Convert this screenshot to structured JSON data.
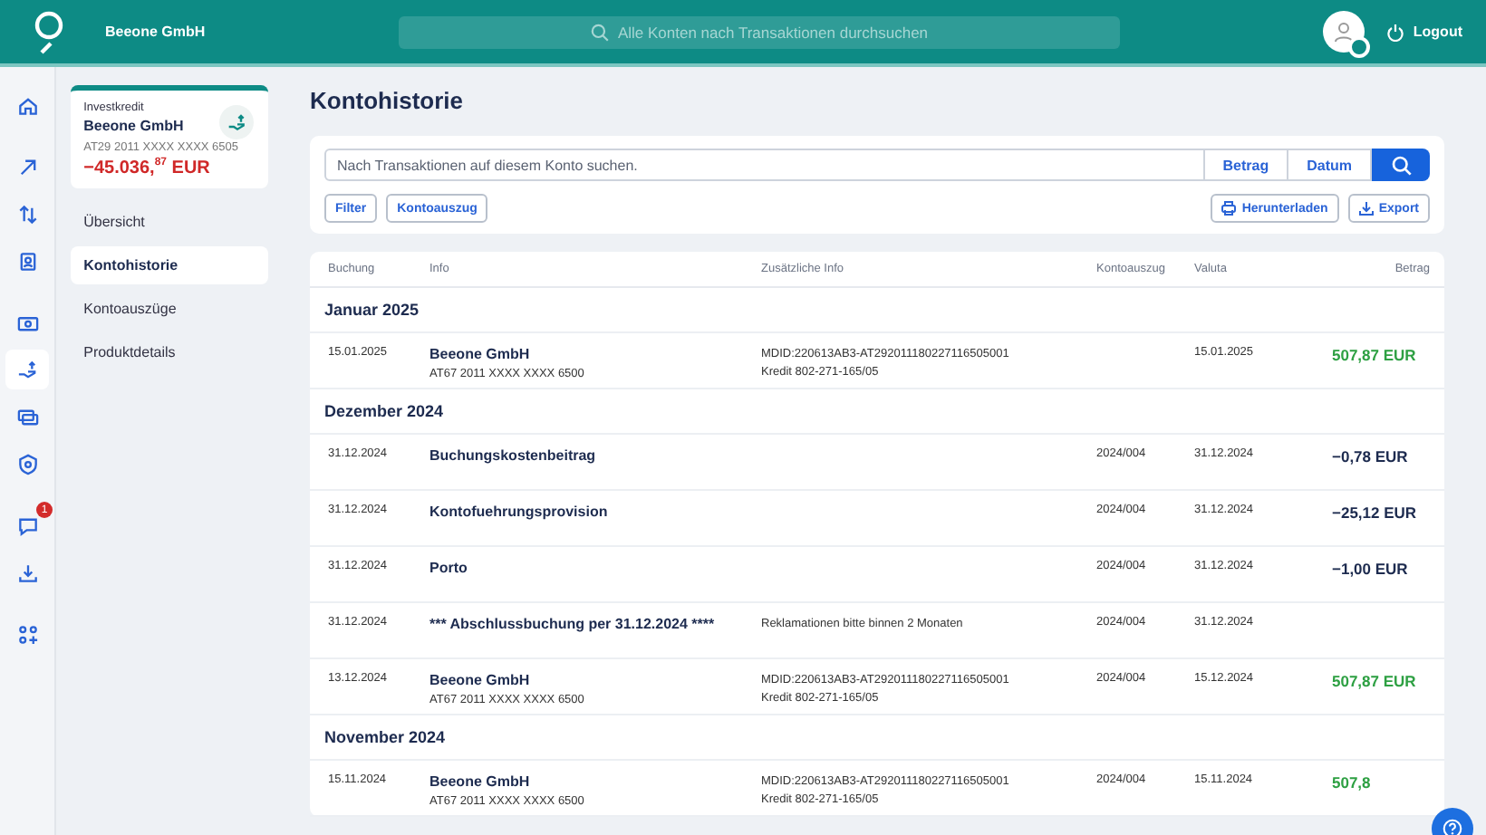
{
  "header": {
    "company": "Beeone GmbH",
    "search_placeholder": "Alle Konten nach Transaktionen durchsuchen",
    "logout": "Logout"
  },
  "rail": [
    {
      "selected": false
    },
    {
      "selected": false
    },
    {
      "selected": false
    },
    {
      "selected": false
    },
    {
      "selected": false
    },
    {
      "selected": true
    },
    {
      "selected": false
    },
    {
      "selected": false
    },
    {
      "selected": false,
      "badge": "1"
    },
    {
      "selected": false
    },
    {
      "selected": false
    }
  ],
  "account": {
    "type": "Investkredit",
    "name": "Beeone GmbH",
    "iban": "AT29 2011 XXXX XXXX 6505",
    "balance": "−45.036,$^{87}$ EUR"
  },
  "nav": [
    {
      "label": "Übersicht",
      "selected": false
    },
    {
      "label": "Kontohistorie",
      "selected": true
    },
    {
      "label": "Kontoauszüge",
      "selected": false
    },
    {
      "label": "Produktdetails",
      "selected": false
    }
  ],
  "title": "Kontohistorie",
  "search": {
    "placeholder": "Nach Transaktionen auf diesem Konto suchen.",
    "buttons": [
      "Betrag",
      "Datum"
    ]
  },
  "filters": [
    "Filter",
    "Kontoauszug"
  ],
  "actions": [
    "Herunterladen",
    "Export"
  ],
  "table": {
    "columns": [
      "Buchung",
      "Info",
      "Zusätzliche Info",
      "Kontoauszug",
      "Valuta",
      "Betrag"
    ],
    "groups": [
      {
        "label": "Januar 2025",
        "rows": [
          {
            "date": "15.01.2025",
            "title": "Beeone GmbH",
            "sub": "AT67 2011 XXXX XXXX 6500",
            "info": [
              "MDID:220613AB3-AT292011180227116505001",
              "Kredit 802-271-165/05"
            ],
            "valuta": "15.01.2025",
            "amount": "507,87 EUR",
            "kind": "credit"
          }
        ]
      },
      {
        "label": "Dezember 2024",
        "rows": [
          {
            "date": "31.12.2024",
            "title": "Buchungskostenbeitrag",
            "statement": "2024/004",
            "valuta": "31.12.2024",
            "amount": "−0,78 EUR",
            "kind": "debit"
          },
          {
            "date": "31.12.2024",
            "title": "Kontofuehrungsprovision",
            "statement": "2024/004",
            "valuta": "31.12.2024",
            "amount": "−25,12 EUR",
            "kind": "debit"
          },
          {
            "date": "31.12.2024",
            "title": "Porto",
            "statement": "2024/004",
            "valuta": "31.12.2024",
            "amount": "−1,00 EUR",
            "kind": "debit"
          },
          {
            "date": "31.12.2024",
            "title": "*** Abschlussbuchung per 31.12.2024 ****",
            "info": [
              "Reklamationen bitte binnen 2 Monaten"
            ],
            "statement": "2024/004",
            "valuta": "31.12.2024"
          },
          {
            "date": "13.12.2024",
            "title": "Beeone GmbH",
            "sub": "AT67 2011 XXXX XXXX 6500",
            "info": [
              "MDID:220613AB3-AT292011180227116505001",
              "Kredit 802-271-165/05"
            ],
            "statement": "2024/004",
            "valuta": "15.12.2024",
            "amount": "507,87 EUR",
            "kind": "credit"
          }
        ]
      },
      {
        "label": "November 2024",
        "rows": [
          {
            "date": "15.11.2024",
            "title": "Beeone GmbH",
            "sub": "AT67 2011 XXXX XXXX 6500",
            "info": [
              "MDID:220613AB3-AT292011180227116505001",
              "Kredit 802-271-165/05"
            ],
            "statement": "2024/004",
            "valuta": "15.11.2024",
            "amount": "507,8",
            "kind": "credit"
          }
        ]
      }
    ]
  }
}
